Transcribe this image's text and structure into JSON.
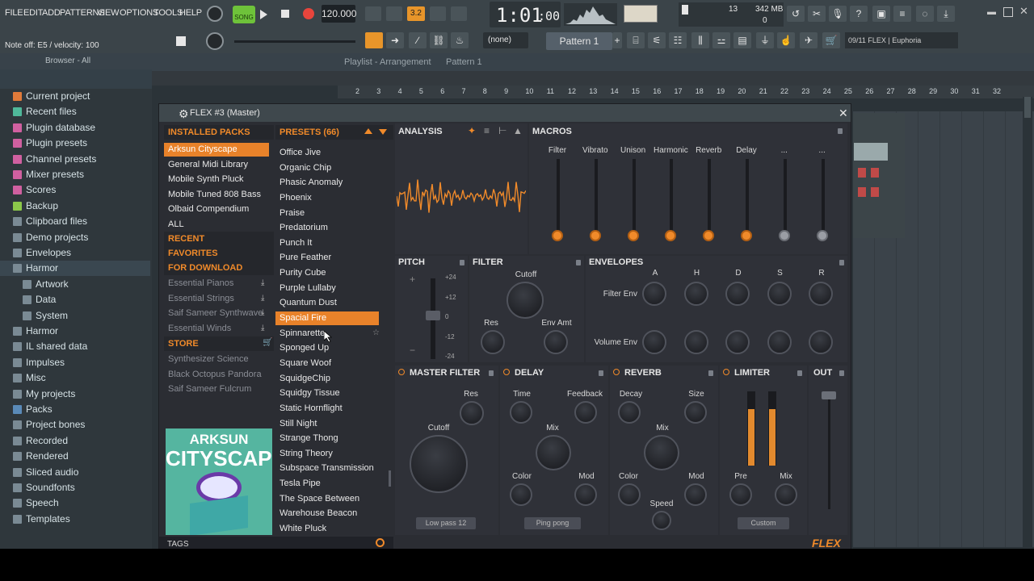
{
  "menu": {
    "file": "FILE",
    "edit": "EDIT",
    "add": "ADD",
    "patterns": "PATTERNS",
    "view": "VIEW",
    "options": "OPTIONS",
    "tools": "TOOLS",
    "help": "HELP"
  },
  "transport": {
    "mode": "SONG",
    "tempo": "120.000",
    "time": "1:01",
    "time_frac": ":00",
    "snap": "3.2",
    "cpu": "13",
    "mem": "342 MB",
    "poly": "0"
  },
  "hint": "Note off: E5 / velocity: 100",
  "toolbar": {
    "snap_select": "(none)",
    "pattern": "Pattern 1",
    "news": "09/11  FLEX | Euphoria"
  },
  "browser": {
    "header": "Browser - All",
    "items": [
      {
        "label": "Current project",
        "color": "#e07a3a"
      },
      {
        "label": "Recent files",
        "color": "#4fb89a"
      },
      {
        "label": "Plugin database",
        "color": "#d060a0"
      },
      {
        "label": "Plugin presets",
        "color": "#d060a0"
      },
      {
        "label": "Channel presets",
        "color": "#d060a0"
      },
      {
        "label": "Mixer presets",
        "color": "#d060a0"
      },
      {
        "label": "Scores",
        "color": "#d060a0"
      },
      {
        "label": "Backup",
        "color": "#8cc84a"
      },
      {
        "label": "Clipboard files",
        "color": "#7a8a94"
      },
      {
        "label": "Demo projects",
        "color": "#7a8a94"
      },
      {
        "label": "Envelopes",
        "color": "#7a8a94"
      },
      {
        "label": "Harmor",
        "color": "#7a8a94"
      },
      {
        "label": "Artwork",
        "color": "#7a8a94"
      },
      {
        "label": "Data",
        "color": "#7a8a94"
      },
      {
        "label": "System",
        "color": "#7a8a94"
      },
      {
        "label": "Harmor",
        "color": "#7a8a94"
      },
      {
        "label": "IL shared data",
        "color": "#7a8a94"
      },
      {
        "label": "Impulses",
        "color": "#7a8a94"
      },
      {
        "label": "Misc",
        "color": "#7a8a94"
      },
      {
        "label": "My projects",
        "color": "#7a8a94"
      },
      {
        "label": "Packs",
        "color": "#5a8ab8"
      },
      {
        "label": "Project bones",
        "color": "#7a8a94"
      },
      {
        "label": "Recorded",
        "color": "#7a8a94"
      },
      {
        "label": "Rendered",
        "color": "#7a8a94"
      },
      {
        "label": "Sliced audio",
        "color": "#7a8a94"
      },
      {
        "label": "Soundfonts",
        "color": "#7a8a94"
      },
      {
        "label": "Speech",
        "color": "#7a8a94"
      },
      {
        "label": "Templates",
        "color": "#7a8a94"
      }
    ]
  },
  "playlist": {
    "title": "Playlist - Arrangement",
    "pattern": "Pattern 1",
    "ruler": [
      "2",
      "3",
      "4",
      "5",
      "6",
      "7",
      "8",
      "9",
      "10",
      "11",
      "12",
      "13",
      "14",
      "15",
      "16",
      "17",
      "18",
      "19",
      "20",
      "21",
      "22",
      "23",
      "24",
      "25",
      "26",
      "27",
      "28",
      "29",
      "30",
      "31",
      "32"
    ]
  },
  "flex": {
    "title": "FLEX #3 (Master)",
    "installed_header": "INSTALLED PACKS",
    "packs": [
      "Arksun Cityscape",
      "General Midi Library",
      "Mobile Synth Pluck",
      "Mobile Tuned 808 Bass",
      "Olbaid Compendium",
      "ALL"
    ],
    "recent": "RECENT",
    "favorites": "FAVORITES",
    "for_download": "FOR DOWNLOAD",
    "downloads": [
      "Essential Pianos",
      "Essential Strings",
      "Saif Sameer Synthwave",
      "Essential Winds"
    ],
    "store": "STORE",
    "store_items": [
      "Synthesizer Science",
      "Black Octopus Pandora",
      "Saif Sameer Fulcrum"
    ],
    "art_title1": "ARKSUN",
    "art_title2": "CITYSCAPE",
    "tags": "TAGS",
    "presets_header": "PRESETS (66)",
    "presets": [
      "Office Jive",
      "Organic Chip",
      "Phasic Anomaly",
      "Phoenix",
      "Praise",
      "Predatorium",
      "Punch It",
      "Pure Feather",
      "Purity Cube",
      "Purple Lullaby",
      "Quantum Dust",
      "Spacial Fire",
      "Spinnarette",
      "Sponged Up",
      "Square Woof",
      "SquidgeChip",
      "Squidgy Tissue",
      "Static Hornflight",
      "Still Night",
      "Strange Thong",
      "String Theory",
      "Subspace Transmission",
      "Tesla Pipe",
      "The Space Between",
      "Warehouse Beacon",
      "White Pluck"
    ],
    "selected_preset": "Spacial Fire",
    "analysis": "ANALYSIS",
    "macros": "MACROS",
    "macro_labels": [
      "Filter",
      "Vibrato",
      "Unison",
      "Harmonic",
      "Reverb",
      "Delay",
      "...",
      "..."
    ],
    "pitch": "PITCH",
    "pitch_scale": [
      "+24",
      "+12",
      "0",
      "-12",
      "-24"
    ],
    "filter": "FILTER",
    "filter_knobs": {
      "cutoff": "Cutoff",
      "res": "Res",
      "env": "Env Amt"
    },
    "envelopes": "ENVELOPES",
    "env_cols": [
      "A",
      "H",
      "D",
      "S",
      "R"
    ],
    "env_rows": [
      "Filter Env",
      "Volume Env"
    ],
    "master_filter": "MASTER FILTER",
    "mf": {
      "res": "Res",
      "cutoff": "Cutoff",
      "mode": "Low pass 12"
    },
    "delay": "DELAY",
    "dl": {
      "time": "Time",
      "feedback": "Feedback",
      "mix": "Mix",
      "color": "Color",
      "mod": "Mod",
      "mode": "Ping pong"
    },
    "reverb": "REVERB",
    "rv": {
      "decay": "Decay",
      "size": "Size",
      "mix": "Mix",
      "color": "Color",
      "mod": "Mod",
      "speed": "Speed"
    },
    "limiter": "LIMITER",
    "lm": {
      "pre": "Pre",
      "mix": "Mix",
      "mode": "Custom"
    },
    "out": "OUT",
    "logo": "FLEX"
  },
  "colors": {
    "accent": "#f08a2a",
    "bg": "#2b2d33"
  }
}
